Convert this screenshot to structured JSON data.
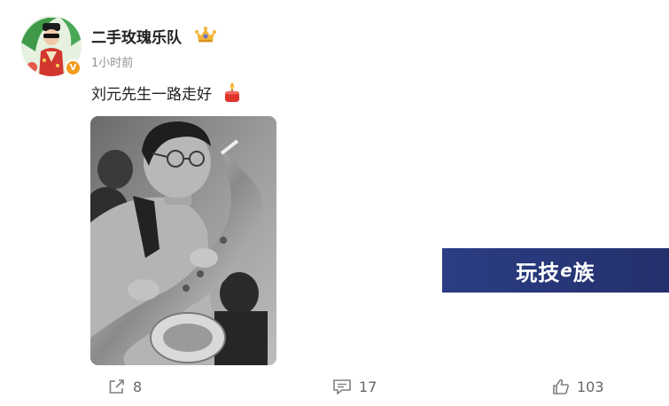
{
  "post": {
    "username": "二手玫瑰乐队",
    "timestamp": "1小时前",
    "text": "刘元先生一路走好",
    "text_emoji_icon": "candle-icon",
    "badge_icon": "crown-badge-icon",
    "verified_mark": "V",
    "verified_color": "#f29a1a"
  },
  "watermark": {
    "part1": "玩技",
    "part2": "e",
    "part3": "族",
    "color": "#2b3d84"
  },
  "actions": {
    "repost": {
      "icon": "share-icon",
      "count": "8"
    },
    "comment": {
      "icon": "comment-icon",
      "count": "17"
    },
    "like": {
      "icon": "thumbs-up-icon",
      "count": "103"
    }
  }
}
